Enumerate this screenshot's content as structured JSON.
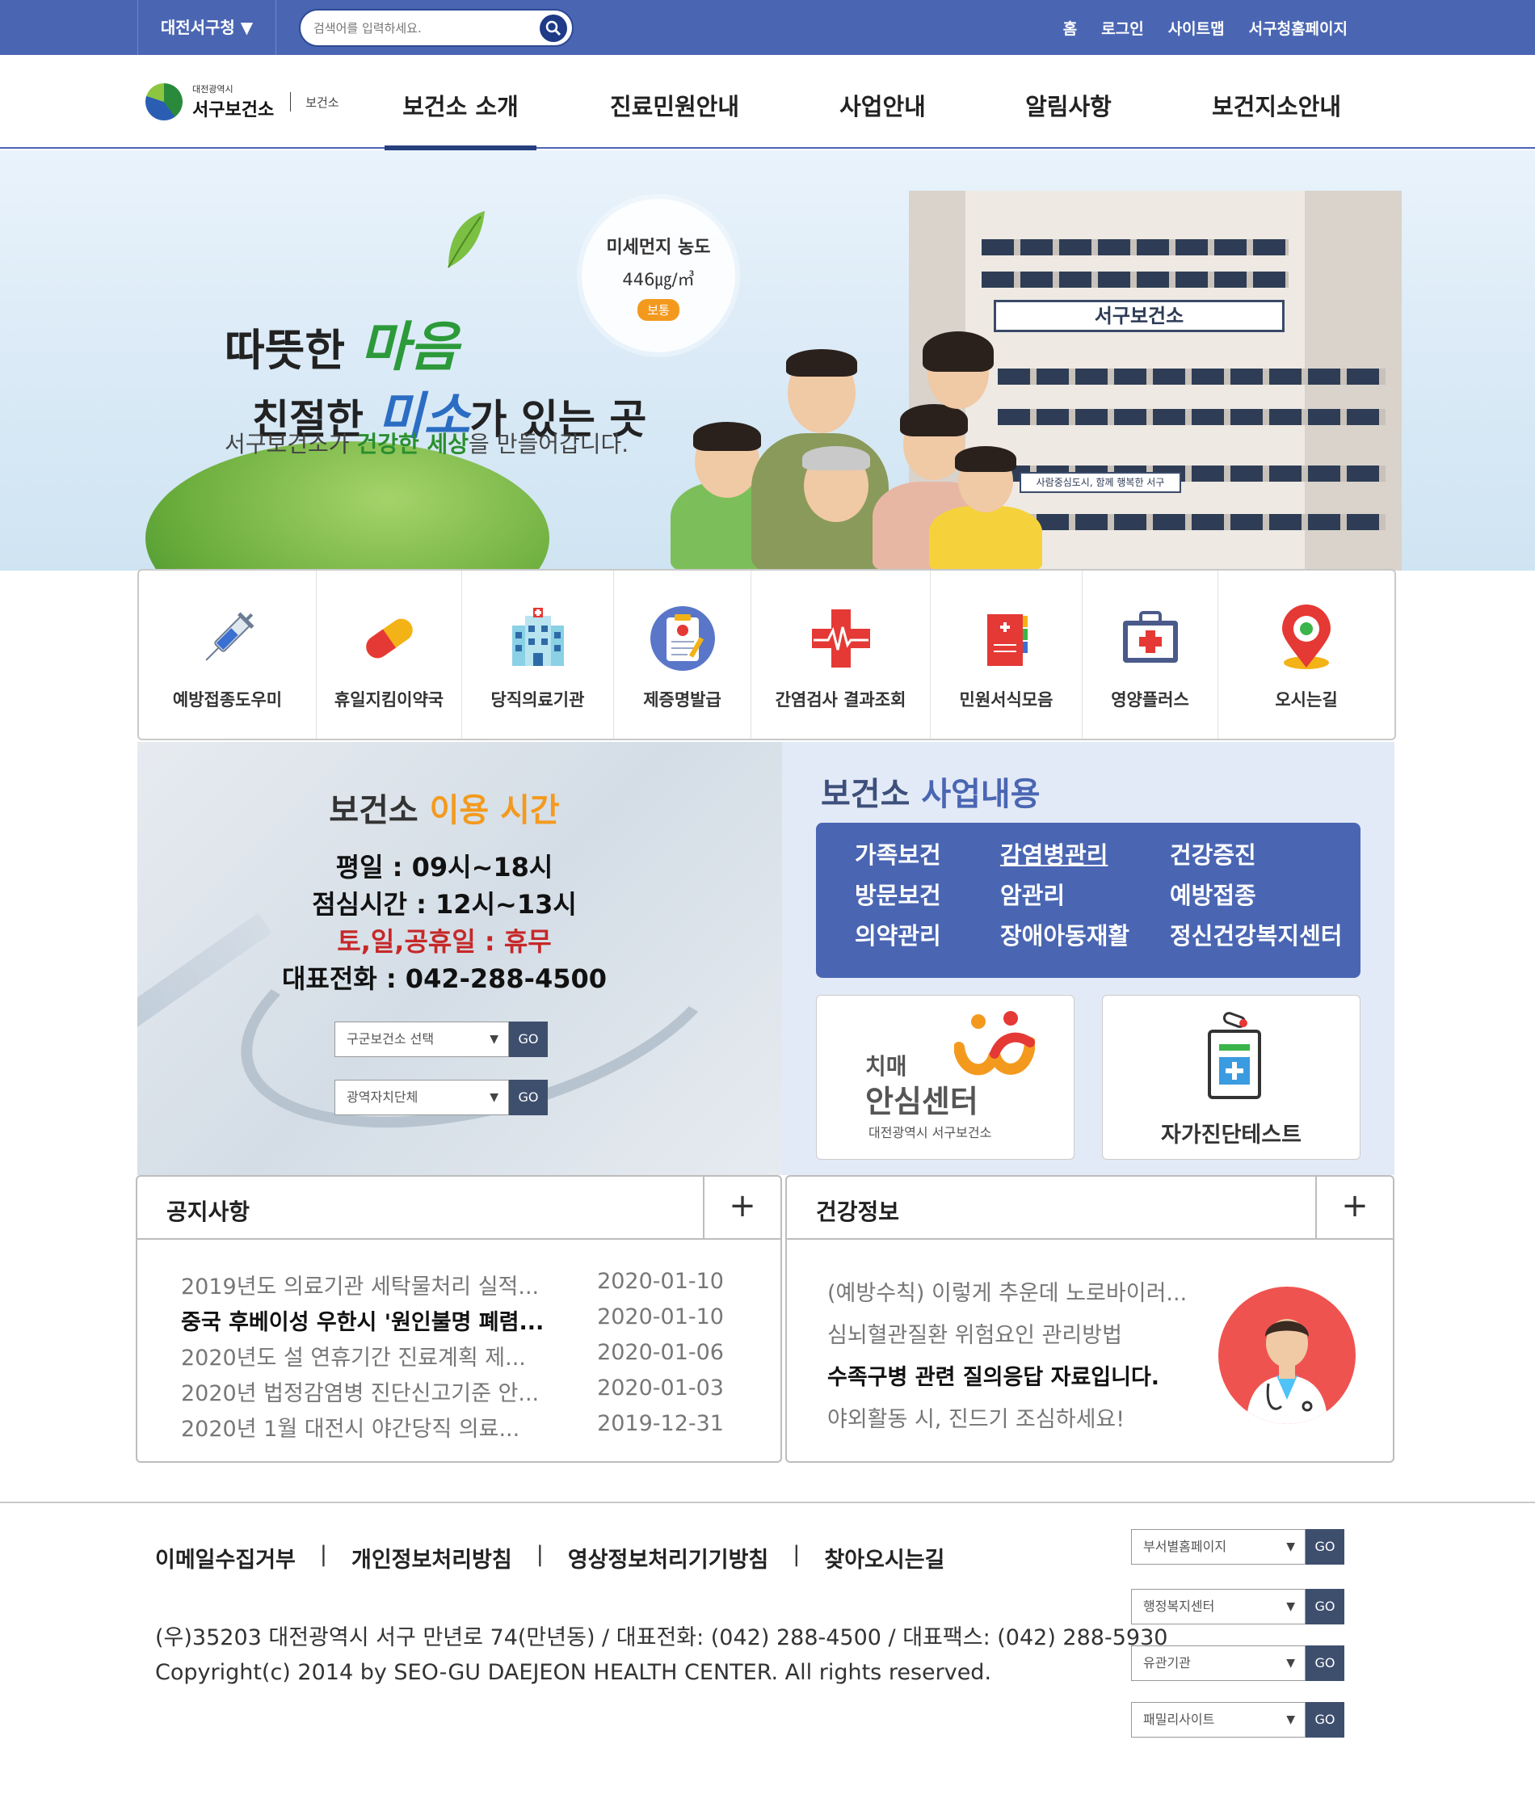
{
  "topbar": {
    "site_select": "대전서구청",
    "search_placeholder": "검색어를 입력하세요.",
    "links": [
      "홈",
      "로그인",
      "사이트맵",
      "서구청홈페이지"
    ]
  },
  "header": {
    "logo_small": "대전광역시",
    "logo_name": "서구보건소",
    "logo_sub": "보건소",
    "nav": [
      "보건소 소개",
      "진료민원안내",
      "사업안내",
      "알림사항",
      "보건지소안내"
    ]
  },
  "hero": {
    "line1_a": "따뜻한 ",
    "line1_b": "마음",
    "line2_a": "친절한 ",
    "line2_b": "미소",
    "line2_c": "가 있는 곳",
    "line3_a": "서구보건소가 ",
    "line3_b": "건강한 세상",
    "line3_c": "을 만들어갑니다.",
    "building_sign": "서구보건소",
    "banner_text": "사람중심도시, 함께 행복한 서구",
    "dust_title": "미세먼지 농도",
    "dust_value": "446㎍/㎥",
    "dust_status": "보통"
  },
  "quick_menu": [
    {
      "label": "예방접종도우미",
      "icon": "syringe-icon"
    },
    {
      "label": "휴일지킴이약국",
      "icon": "pill-icon"
    },
    {
      "label": "당직의료기관",
      "icon": "hospital-icon"
    },
    {
      "label": "제증명발급",
      "icon": "clipboard-icon"
    },
    {
      "label": "간염검사 결과조회",
      "icon": "medical-cross-icon"
    },
    {
      "label": "민원서식모음",
      "icon": "document-icon"
    },
    {
      "label": "영양플러스",
      "icon": "first-aid-kit-icon"
    },
    {
      "label": "오시는길",
      "icon": "map-pin-icon"
    }
  ],
  "hours": {
    "title_a": "보건소 ",
    "title_b": "이용 시간",
    "weekday": "평일 : 09시~18시",
    "lunch": "점심시간 : 12시~13시",
    "holiday": "토,일,공휴일 : 휴무",
    "phone": "대표전화 : 042-288-4500",
    "select1": "구군보건소 선택",
    "select2": "광역자치단체",
    "go": "GO"
  },
  "business": {
    "title_a": "보건소 ",
    "title_b": "사업내용",
    "col1": [
      "가족보건",
      "방문보건",
      "의약관리"
    ],
    "col2": [
      "감염병관리",
      "암관리",
      "장애아동재활"
    ],
    "col3": [
      "건강증진",
      "예방접종",
      "정신건강복지센터"
    ],
    "dementia_a": "치매",
    "dementia_b": "안심센터",
    "dementia_c": "대전광역시  서구보건소",
    "selftest": "자가진단테스트"
  },
  "notice": {
    "title": "공지사항",
    "plus": "+",
    "items": [
      {
        "title": "2019년도 의료기관 세탁물처리 실적...",
        "date": "2020-01-10"
      },
      {
        "title": "중국 후베이성 우한시 '원인불명 폐렴...",
        "date": "2020-01-10"
      },
      {
        "title": "2020년도 설 연휴기간 진료계획 제...",
        "date": "2020-01-06"
      },
      {
        "title": "2020년 법정감염병 진단신고기준 안...",
        "date": "2020-01-03"
      },
      {
        "title": "2020년 1월 대전시 야간당직 의료...",
        "date": "2019-12-31"
      }
    ]
  },
  "health": {
    "title": "건강정보",
    "plus": "+",
    "items": [
      "(예방수칙) 이렇게 추운데 노로바이러...",
      "심뇌혈관질환 위험요인 관리방법",
      "수족구병 관련 질의응답 자료입니다.",
      "야외활동 시, 진드기 조심하세요!"
    ]
  },
  "footer": {
    "links": [
      "이메일수집거부",
      "개인정보처리방침",
      "영상정보처리기기방침",
      "찾아오시는길"
    ],
    "separator": "|",
    "address": "(우)35203 대전광역시 서구 만년로 74(만년동) / 대표전화: (042) 288-4500 / 대표팩스: (042) 288-5930",
    "copyright": "Copyright(c) 2014 by SEO-GU DAEJEON HEALTH CENTER. All rights reserved.",
    "selects": [
      "부서별홈페이지",
      "행정복지센터",
      "유관기관",
      "패밀리사이트"
    ],
    "go": "GO"
  },
  "colors": {
    "primary": "#4a66b3",
    "accent": "#f39a1e",
    "alert": "#c62828",
    "dark_nav": "#263f7e"
  }
}
